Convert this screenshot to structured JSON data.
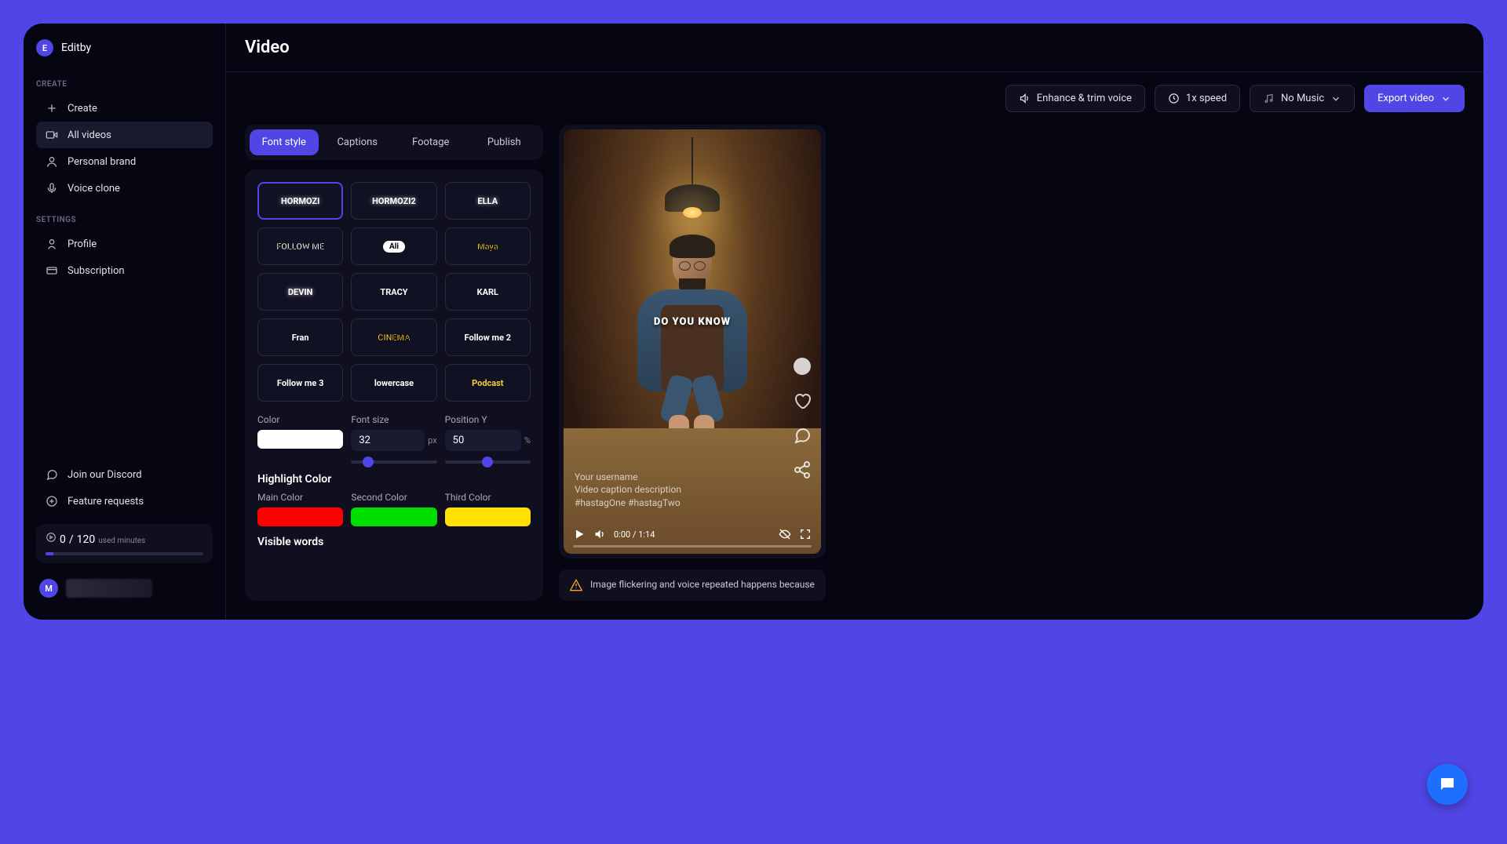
{
  "brand": {
    "initial": "E",
    "name": "Editby"
  },
  "sidebar": {
    "sections": {
      "create_label": "CREATE",
      "settings_label": "SETTINGS"
    },
    "items": {
      "create": "Create",
      "all_videos": "All videos",
      "personal_brand": "Personal brand",
      "voice_clone": "Voice clone",
      "profile": "Profile",
      "subscription": "Subscription",
      "discord": "Join our Discord",
      "feature_requests": "Feature requests"
    },
    "usage": {
      "used": "0",
      "sep": "/",
      "total": "120",
      "suffix": "used minutes"
    },
    "user_initial": "M"
  },
  "page_title": "Video",
  "toolbar": {
    "enhance": "Enhance & trim voice",
    "speed": "1x speed",
    "music": "No Music",
    "export": "Export video"
  },
  "tabs": {
    "font_style": "Font style",
    "captions": "Captions",
    "footage": "Footage",
    "publish": "Publish"
  },
  "presets": [
    {
      "label": "HORMOZI",
      "style": "glow",
      "color": "#ffffff",
      "selected": true
    },
    {
      "label": "HORMOZI2",
      "style": "glow",
      "color": "#ffffff"
    },
    {
      "label": "ELLA",
      "style": "glow",
      "color": "#ffffff"
    },
    {
      "label": "FOLLOW ME",
      "style": "outline",
      "color": "#ffffff"
    },
    {
      "label": "Ali",
      "style": "pill",
      "color": "#000000"
    },
    {
      "label": "Maya",
      "style": "outline",
      "color": "#f5d040"
    },
    {
      "label": "DEVIN",
      "style": "glow",
      "color": "#ffffff"
    },
    {
      "label": "TRACY",
      "style": "",
      "color": "#ffffff"
    },
    {
      "label": "KARL",
      "style": "",
      "color": "#ffffff"
    },
    {
      "label": "Fran",
      "style": "",
      "color": "#ffffff"
    },
    {
      "label": "CINEMA",
      "style": "outline",
      "color": "#f5d040"
    },
    {
      "label": "Follow me 2",
      "style": "",
      "color": "#ffffff"
    },
    {
      "label": "Follow me 3",
      "style": "",
      "color": "#ffffff"
    },
    {
      "label": "lowercase",
      "style": "",
      "color": "#ffffff"
    },
    {
      "label": "Podcast",
      "style": "",
      "color": "#f5d040"
    }
  ],
  "controls": {
    "color_label": "Color",
    "color_value": "#ffffff",
    "font_size_label": "Font size",
    "font_size_value": "32",
    "font_size_unit": "px",
    "position_y_label": "Position Y",
    "position_y_value": "50",
    "position_y_unit": "%",
    "highlight_heading": "Highlight Color",
    "main_color_label": "Main Color",
    "main_color": "#ff0000",
    "second_color_label": "Second Color",
    "second_color": "#00e000",
    "third_color_label": "Third Color",
    "third_color": "#ffe000",
    "visible_words_heading": "Visible words"
  },
  "preview": {
    "caption": "DO YOU KNOW",
    "username": "Your username",
    "description": "Video caption description",
    "hashtags": "#hastagOne #hastagTwo",
    "time": "0:00 / 1:14"
  },
  "warning": "Image flickering and voice repeated happens because"
}
